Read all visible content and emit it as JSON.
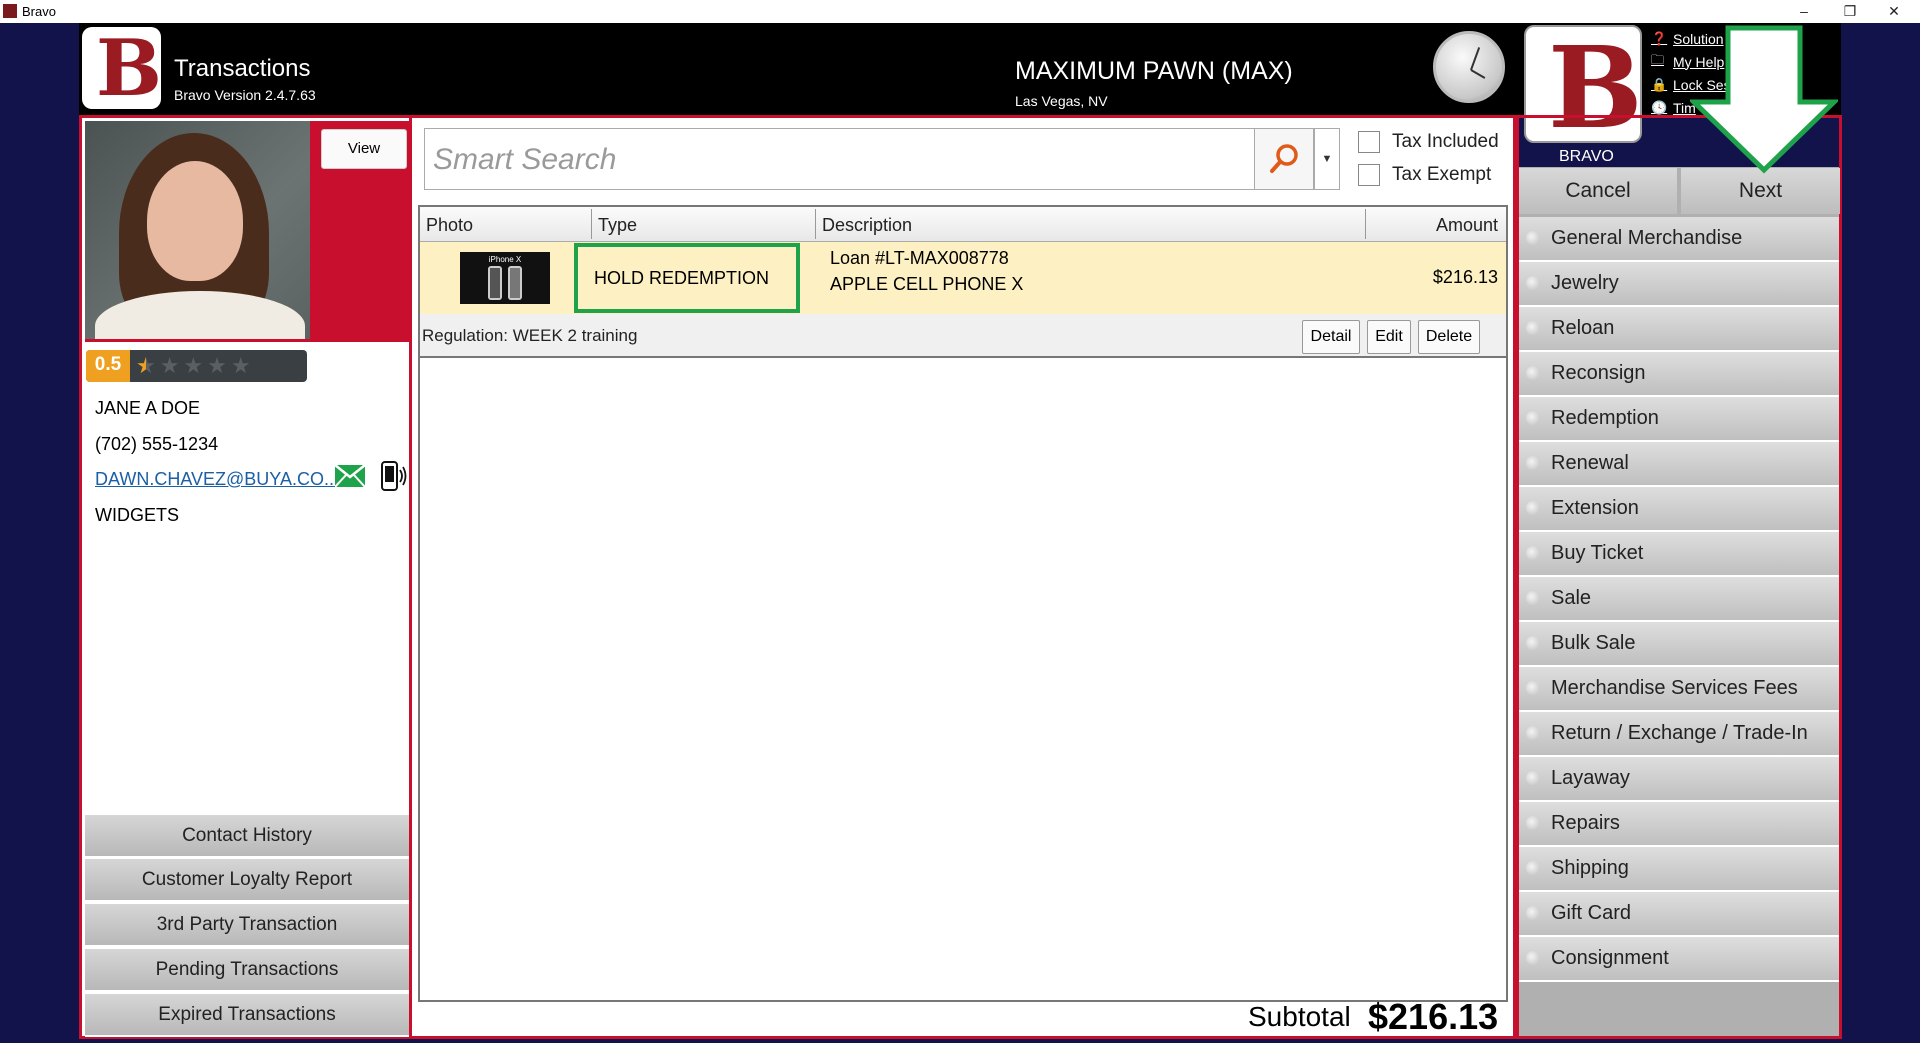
{
  "window": {
    "title": "Bravo",
    "minimize": "–",
    "restore": "❐",
    "close": "✕"
  },
  "header": {
    "app_title": "Transactions",
    "version": "Bravo Version 2.4.7.63",
    "store_name": "MAXIMUM PAWN (MAX)",
    "store_location": "Las Vegas, NV",
    "brand_label": "BRAVO",
    "links": [
      {
        "icon": "help-icon",
        "label": "Solution"
      },
      {
        "icon": "folder-icon",
        "label": "My Help"
      },
      {
        "icon": "lock-icon",
        "label": "Lock Ses"
      },
      {
        "icon": "clock-icon",
        "label": "Tim"
      }
    ]
  },
  "customer": {
    "view_label": "View",
    "rating": "0.5",
    "stars": "★★★★★",
    "name": "JANE A DOE",
    "phone": "(702) 555-1234",
    "email": "DAWN.CHAVEZ@BUYA.CO...",
    "company": "WIDGETS"
  },
  "left_buttons": [
    "Contact History",
    "Customer Loyalty Report",
    "3rd Party Transaction",
    "Pending Transactions",
    "Expired Transactions"
  ],
  "search": {
    "placeholder": "Smart Search",
    "tax_included": "Tax Included",
    "tax_exempt": "Tax Exempt"
  },
  "grid": {
    "columns": [
      "Photo",
      "Type",
      "Description",
      "Amount"
    ],
    "rows": [
      {
        "photo_caption": "iPhone X",
        "type": "HOLD REDEMPTION",
        "description_line1": "Loan #LT-MAX008778",
        "description_line2": "APPLE CELL PHONE X",
        "amount": "$216.13",
        "regulation": "Regulation: WEEK 2 training",
        "detail_label": "Detail",
        "edit_label": "Edit",
        "delete_label": "Delete"
      }
    ]
  },
  "totals": {
    "subtotal_label": "Subtotal",
    "subtotal_value": "$216.13"
  },
  "actions": {
    "cancel": "Cancel",
    "next": "Next"
  },
  "transaction_types": [
    "General Merchandise",
    "Jewelry",
    "Reloan",
    "Reconsign",
    "Redemption",
    "Renewal",
    "Extension",
    "Buy Ticket",
    "Sale",
    "Bulk Sale",
    "Merchandise Services Fees",
    "Return / Exchange / Trade-In",
    "Layaway",
    "Repairs",
    "Shipping",
    "Gift Card",
    "Consignment"
  ],
  "colors": {
    "brand_red": "#c8102e",
    "logo_red": "#9b1b22",
    "highlight_row": "#fdf0c2",
    "annotation_green": "#1ea34a",
    "background_navy": "#11134a"
  }
}
